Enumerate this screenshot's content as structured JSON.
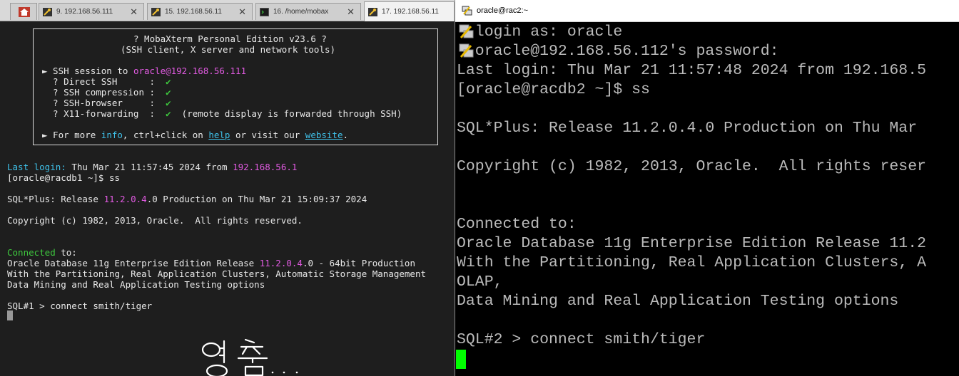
{
  "mobaxterm": {
    "tabs": [
      {
        "label": "9. 192.168.56.111",
        "close": "✕"
      },
      {
        "label": "15. 192.168.56.11",
        "close": "✕"
      },
      {
        "label": "16. /home/mobax",
        "close": "✕"
      },
      {
        "label": "17. 192.168.56.11",
        "close": ""
      }
    ],
    "banner": {
      "title": "? MobaXterm Personal Edition v23.6 ?",
      "subtitle": "(SSH client, X server and network tools)",
      "session_prefix": "► SSH session to ",
      "session_target": "oracle@192.168.56.111",
      "features": [
        {
          "label": "  ? Direct SSH      :  ",
          "mark": "✔",
          "note": ""
        },
        {
          "label": "  ? SSH compression :  ",
          "mark": "✔",
          "note": ""
        },
        {
          "label": "  ? SSH-browser     :  ",
          "mark": "✔",
          "note": ""
        },
        {
          "label": "  ? X11-forwarding  :  ",
          "mark": "✔",
          "note": "  (remote display is forwarded through SSH)"
        }
      ],
      "more_prefix": "► For more ",
      "more_info": "info",
      "more_mid": ", ctrl+click on ",
      "more_help": "help",
      "more_mid2": " or visit our ",
      "more_site": "website",
      "more_end": "."
    },
    "terminal": {
      "last_login_label": "Last login:",
      "last_login_text": " Thu Mar 21 11:57:45 2024 from ",
      "last_login_ip": "192.168.56.1",
      "prompt1": "[oracle@racdb1 ~]$ ss",
      "sqlplus_prefix": "SQL*Plus: Release ",
      "sqlplus_ver": "11.2.0.4",
      "sqlplus_rest": ".0 Production on Thu Mar 21 15:09:37 2024",
      "copyright": "Copyright (c) 1982, 2013, Oracle.  All rights reserved.",
      "connected_word": "Connected",
      "connected_rest": " to:",
      "db_prefix": "Oracle Database 11g Enterprise Edition Release ",
      "db_ver": "11.2.0.4",
      "db_rest": ".0 - 64bit Production",
      "partitioning": "With the Partitioning, Real Application Clusters, Automatic Storage Management",
      "datamining": "Data Mining and Real Application Testing options",
      "sql_prompt": "SQL#1 > connect smith/tiger"
    }
  },
  "putty": {
    "title": "oracle@rac2:~",
    "lines": [
      "  login as: oracle",
      "  oracle@192.168.56.112's password:",
      "Last login: Thu Mar 21 11:57:48 2024 from 192.168.5",
      "[oracle@racdb2 ~]$ ss",
      "",
      "SQL*Plus: Release 11.2.0.4.0 Production on Thu Mar",
      "",
      "Copyright (c) 1982, 2013, Oracle.  All rights reser",
      "",
      "",
      "Connected to:",
      "Oracle Database 11g Enterprise Edition Release 11.2",
      "With the Partitioning, Real Application Clusters, A",
      "OLAP,",
      "Data Mining and Real Application Testing options",
      "",
      "SQL#2 > connect smith/tiger"
    ]
  },
  "colors": {
    "moba_bg": "#1e1e1e",
    "magenta": "#e05ae0",
    "cyan": "#3fc0e8",
    "green": "#3ec83e",
    "yellow": "#e0e04a",
    "putty_fg": "#bbbbbb",
    "putty_cursor": "#00ff00"
  },
  "icons": [
    "home-icon",
    "ssh-key-icon",
    "terminal-icon",
    "putty-icon",
    "close-icon"
  ]
}
